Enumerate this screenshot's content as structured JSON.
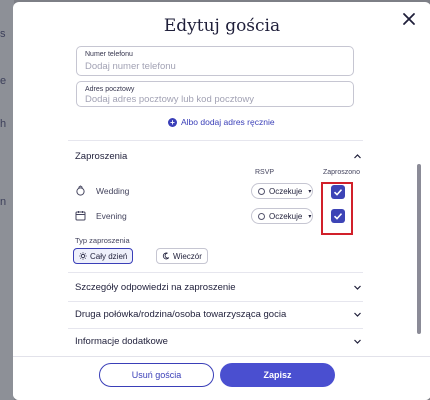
{
  "background": {
    "glyphs": [
      "s",
      "e",
      "h",
      "n"
    ]
  },
  "modal": {
    "title": "Edytuj gościa",
    "close_icon": "close-icon"
  },
  "contact": {
    "phone": {
      "label": "Numer telefonu",
      "placeholder": "Dodaj numer telefonu"
    },
    "address": {
      "label": "Adres pocztowy",
      "placeholder": "Dodaj adres pocztowy lub kod pocztowy"
    },
    "manual_link": "Albo dodaj adres ręcznie"
  },
  "invitations": {
    "title": "Zaproszenia",
    "rsvp_header": "RSVP",
    "invited_header": "Zaproszono",
    "events": [
      {
        "name": "Wedding",
        "icon": "ring-icon",
        "rsvp": "Oczekuje",
        "invited": true
      },
      {
        "name": "Evening",
        "icon": "calendar-icon",
        "rsvp": "Oczekuje",
        "invited": true
      }
    ],
    "type_label": "Typ zaproszenia",
    "types": [
      {
        "label": "Cały dzień",
        "icon": "sun-icon",
        "selected": true
      },
      {
        "label": "Wieczór",
        "icon": "moon-icon",
        "selected": false
      }
    ]
  },
  "sections": [
    {
      "title": "Szczegóły odpowiedzi na zaproszenie"
    },
    {
      "title": "Druga połówka/rodzina/osoba towarzysząca gocia"
    },
    {
      "title": "Informacje dodatkowe"
    }
  ],
  "footer": {
    "delete_label": "Usuń gościa",
    "save_label": "Zapisz"
  },
  "colors": {
    "accent": "#3a3fb8",
    "save": "#4a4fd0",
    "highlight": "#d1202a"
  }
}
